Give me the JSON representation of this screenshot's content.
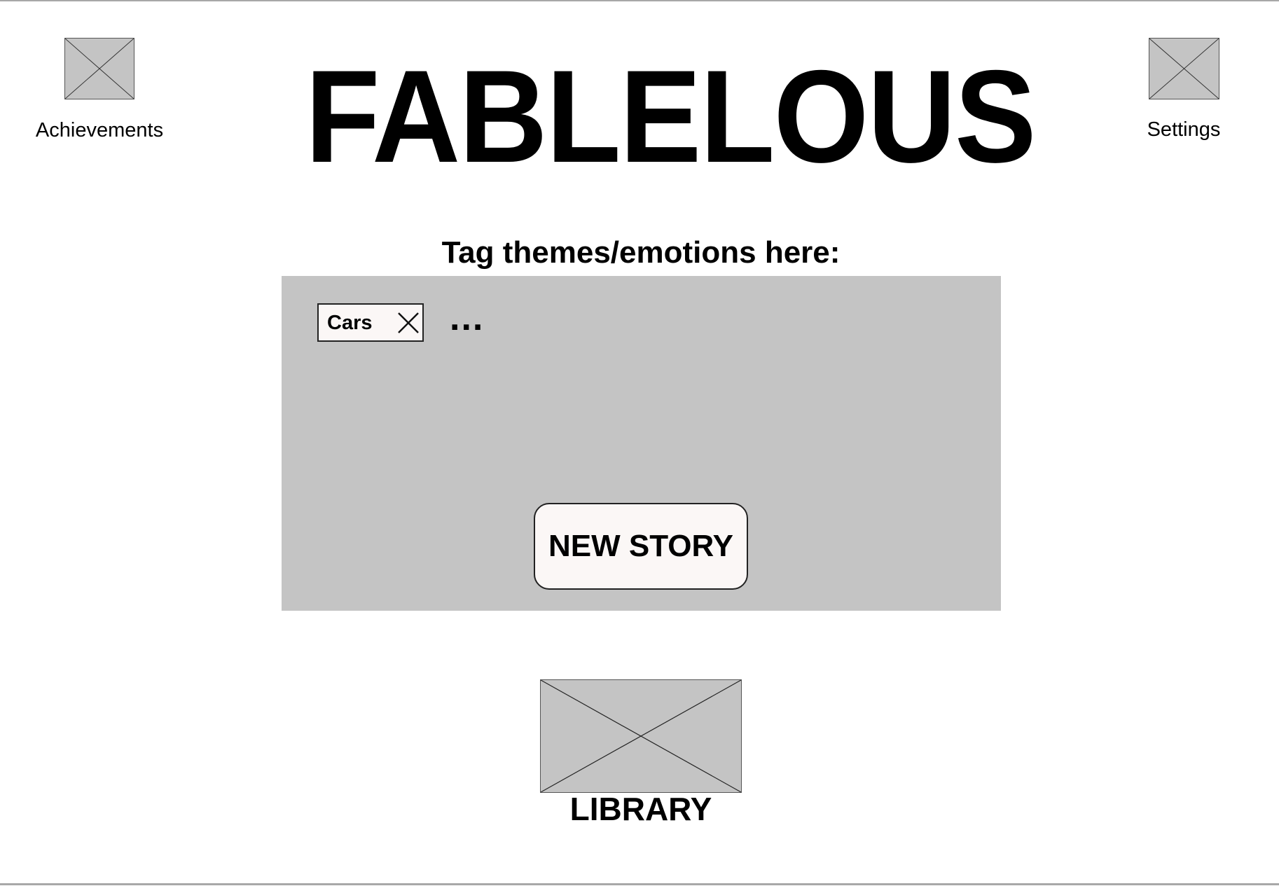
{
  "app": {
    "title": "FABLELOUS"
  },
  "nav": {
    "achievements_label": "Achievements",
    "achievements_icon": "image-placeholder-icon",
    "settings_label": "Settings",
    "settings_icon": "image-placeholder-icon",
    "library_label": "LIBRARY",
    "library_icon": "image-placeholder-icon"
  },
  "tags": {
    "prompt": "Tag themes/emotions here:",
    "items": [
      {
        "label": "Cars",
        "remove_icon": "close-icon"
      }
    ],
    "more_indicator": "..."
  },
  "actions": {
    "new_story_label": "NEW STORY"
  },
  "colors": {
    "panel": "#c4c4c4",
    "chip": "#fbf7f6",
    "text": "#000000"
  }
}
